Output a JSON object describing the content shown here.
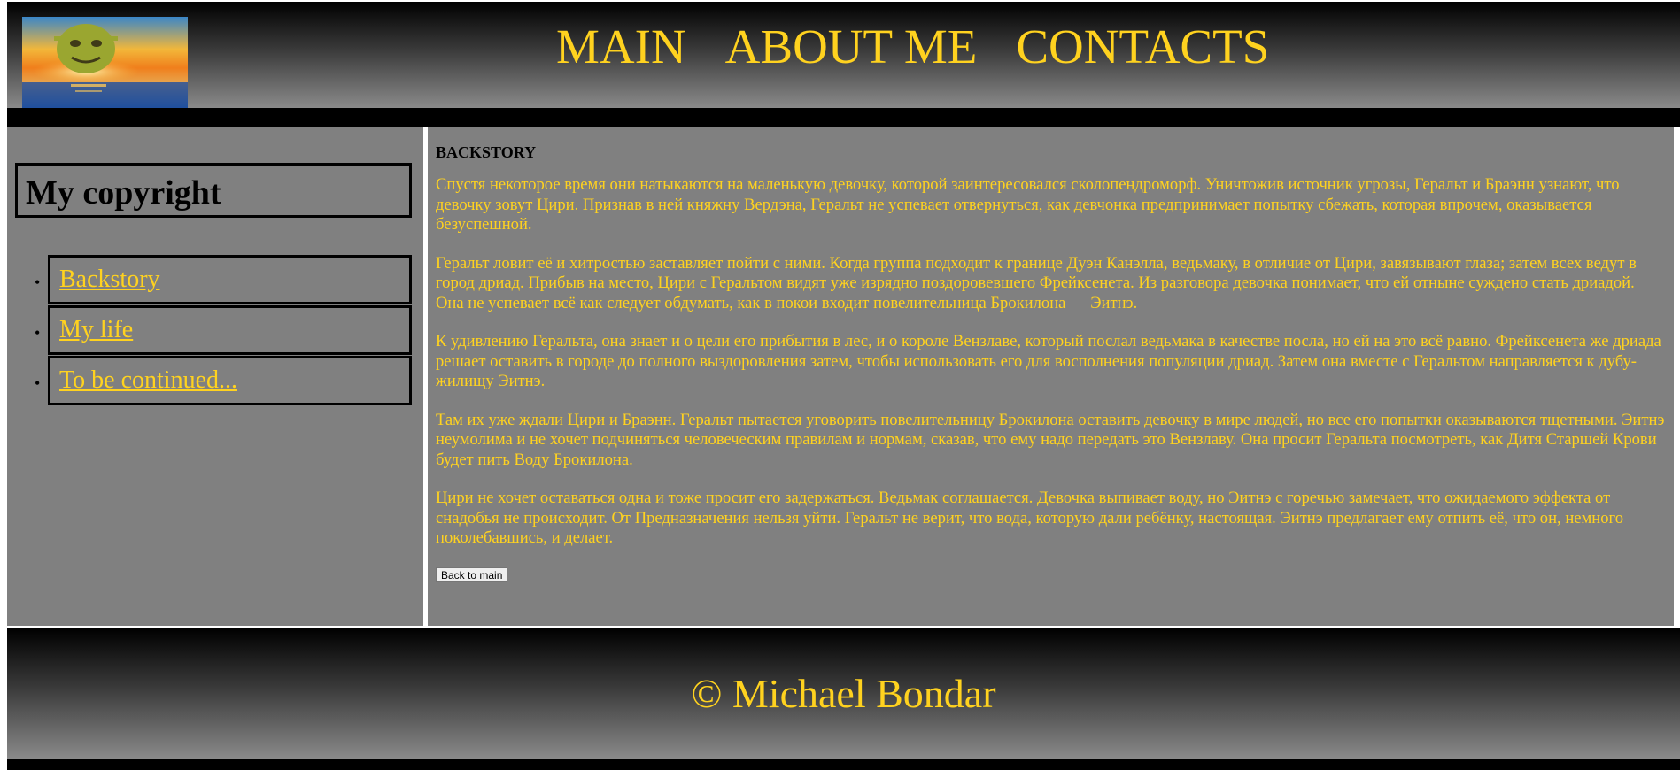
{
  "header": {
    "nav": [
      "MAIN",
      "ABOUT ME",
      "CONTACTS"
    ]
  },
  "sidebar": {
    "copyright_title": "My copyright",
    "items": [
      "Backstory",
      "My life",
      "To be continued..."
    ]
  },
  "content": {
    "heading": "BACKSTORY",
    "paragraphs": [
      "Спустя некоторое время они натыкаются на маленькую девочку, которой заинтересовался сколопендроморф. Уничтожив источник угрозы, Геральт и Браэнн узнают, что девочку зовут Цири. Признав в ней княжну Вердэна, Геральт не успевает отвернуться, как девчонка предпринимает попытку сбежать, которая впрочем, оказывается безуспешной.",
      "Геральт ловит её и хитростью заставляет пойти с ними. Когда группа подходит к границе Дуэн Канэлла, ведьмаку, в отличие от Цири, завязывают глаза; затем всех ведут в город дриад. Прибыв на место, Цири с Геральтом видят уже изрядно поздоровевшего Фрейксенета. Из разговора девочка понимает, что ей отныне суждено стать дриадой. Она не успевает всё как следует обдумать, как в покои входит повелительница Брокилона — Эитнэ.",
      "К удивлению Геральта, она знает и о цели его прибытия в лес, и о короле Вензлаве, который послал ведьмака в качестве посла, но ей на это всё равно. Фрейксенета же дриада решает оставить в городе до полного выздоровления затем, чтобы использовать его для восполнения популяции дриад. Затем она вместе с Геральтом направляется к дубу-жилищу Эитнэ.",
      "Там их уже ждали Цири и Браэнн. Геральт пытается уговорить повелительницу Брокилона оставить девочку в мире людей, но все его попытки оказываются тщетными. Эитнэ неумолима и не хочет подчиняться человеческим правилам и нормам, сказав, что ему надо передать это Вензлаву. Она просит Геральта посмотреть, как Дитя Старшей Крови будет пить Воду Брокилона.",
      "Цири не хочет оставаться одна и тоже просит его задержаться. Ведьмак соглашается. Девочка выпивает воду, но Эитнэ с горечью замечает, что ожидаемого эффекта от снадобья не происходит. От Предназначения нельзя уйти. Геральт не верит, что вода, которую дали ребёнку, настоящая. Эитнэ предлагает ему отпить её, что он, немного поколебавшись, и делает."
    ],
    "back_button": "Back to main"
  },
  "footer": {
    "text": "© Michael Bondar"
  },
  "colors": {
    "accent": "#ffd21f",
    "panel": "#808080",
    "bar": "#000000"
  }
}
